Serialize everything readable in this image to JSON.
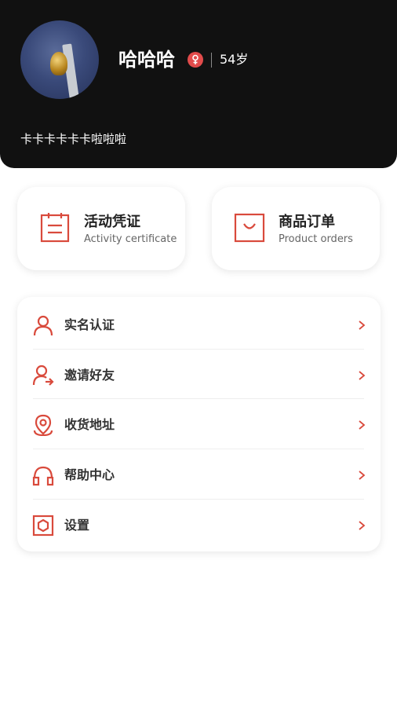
{
  "profile": {
    "name": "哈哈哈",
    "age": "54岁",
    "bio": "卡卡卡卡卡卡啦啦啦"
  },
  "cards": [
    {
      "title": "活动凭证",
      "subtitle": "Activity certificate",
      "icon": "clipboard-icon"
    },
    {
      "title": "商品订单",
      "subtitle": "Product orders",
      "icon": "shopping-bag-icon"
    }
  ],
  "menu": [
    {
      "label": "实名认证",
      "icon": "user-icon"
    },
    {
      "label": "邀请好友",
      "icon": "invite-user-icon"
    },
    {
      "label": "收货地址",
      "icon": "location-pin-icon"
    },
    {
      "label": "帮助中心",
      "icon": "headphones-icon"
    },
    {
      "label": "设置",
      "icon": "settings-hexagon-icon"
    }
  ],
  "colors": {
    "accent": "#d94a3c",
    "header_bg": "#111111",
    "gender_badge": "#e24b4b"
  }
}
